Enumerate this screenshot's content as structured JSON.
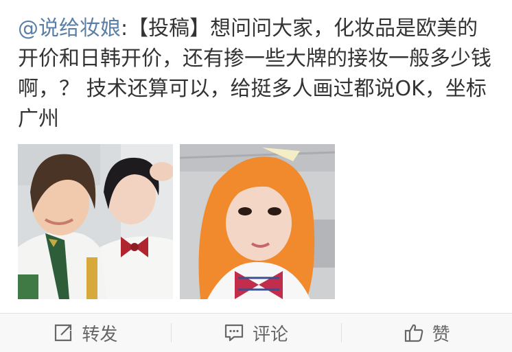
{
  "post": {
    "mention": "@说给妆娘",
    "separator": ":",
    "body": "【投稿】想问问大家，化妆品是欧美的开价和日韩开价，还有掺一些大牌的接妆一般多少钱啊，？ 技术还算可以，给挺多人画过都说OK，坐标广州"
  },
  "photos": [
    {
      "name": "photo-cosplay-two-students"
    },
    {
      "name": "photo-cosplay-orange-wig"
    }
  ],
  "actions": {
    "repost": {
      "label": "转发",
      "icon": "edit-square-icon"
    },
    "comment": {
      "label": "评论",
      "icon": "comment-bubble-icon"
    },
    "like": {
      "label": "赞",
      "icon": "thumbs-up-icon"
    }
  },
  "colors": {
    "mention": "#5b7fa6",
    "text": "#333333",
    "action_bar": "#f8f8f8",
    "action_label": "#666666"
  }
}
